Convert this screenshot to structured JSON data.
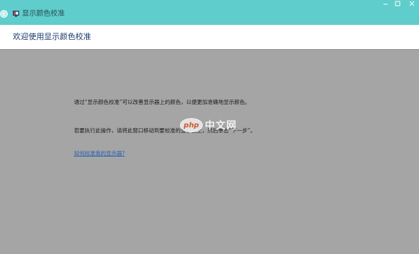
{
  "window": {
    "title": "显示颜色校准",
    "back_icon": "back-arrow-icon",
    "app_icon": "display-monitor-icon"
  },
  "header": {
    "heading": "欢迎使用显示颜色校准"
  },
  "content": {
    "paragraph_1": "通过“显示颜色校准”可以改善显示器上的颜色，以便更加准确地显示颜色。",
    "paragraph_2": "若要执行此操作，请将此窗口移动到要校准的显示器上，然后单击“下一步”。",
    "help_link": "如何校准我的显示器?"
  },
  "watermark": {
    "logo_text": "php",
    "site_text": "中文网"
  },
  "colors": {
    "titlebar": "#5fcdcb",
    "content_bg": "#a5a5a5",
    "link": "#2a5fb0"
  }
}
